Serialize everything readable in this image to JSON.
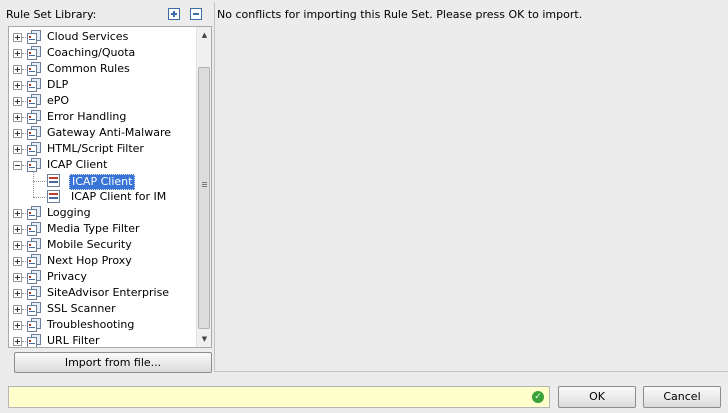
{
  "library": {
    "title": "Rule Set Library:",
    "expand_icon": "expand-all-icon",
    "collapse_icon": "collapse-all-icon"
  },
  "tree": {
    "folders_before": [
      {
        "label": "Cloud Services"
      },
      {
        "label": "Coaching/Quota"
      },
      {
        "label": "Common Rules"
      },
      {
        "label": "DLP"
      },
      {
        "label": "ePO"
      },
      {
        "label": "Error Handling"
      },
      {
        "label": "Gateway Anti-Malware"
      },
      {
        "label": "HTML/Script Filter"
      }
    ],
    "expanded_folder": {
      "label": "ICAP Client",
      "children": [
        {
          "label": "ICAP Client",
          "selected": true
        },
        {
          "label": "ICAP Client for IM",
          "selected": false
        }
      ]
    },
    "folders_after": [
      {
        "label": "Logging"
      },
      {
        "label": "Media Type Filter"
      },
      {
        "label": "Mobile Security"
      },
      {
        "label": "Next Hop Proxy"
      },
      {
        "label": "Privacy"
      },
      {
        "label": "SiteAdvisor Enterprise"
      },
      {
        "label": "SSL Scanner"
      },
      {
        "label": "Troubleshooting"
      },
      {
        "label": "URL Filter"
      }
    ]
  },
  "import_button": "Import from file...",
  "message": "No conflicts for importing this Rule Set. Please press OK to import.",
  "status": {
    "icon": "check-circle-icon",
    "color": "#3aa23a"
  },
  "buttons": {
    "ok": "OK",
    "cancel": "Cancel"
  },
  "colors": {
    "selection": "#3875d7",
    "status_bg": "#ffffcc"
  }
}
